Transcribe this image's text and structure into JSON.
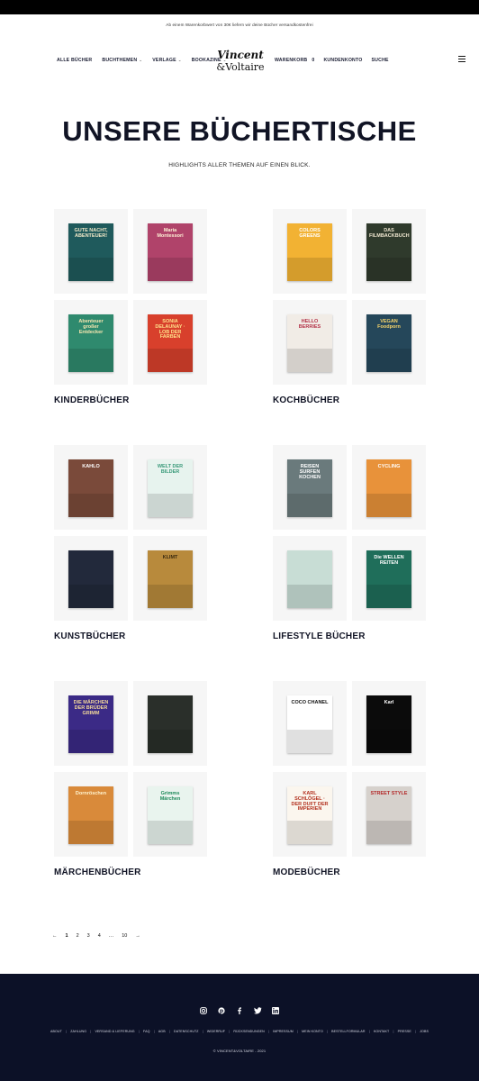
{
  "promo_bar": {
    "text": "Ab einem Warenkorbwert von 30€ liefern wir deine Bücher versandkostenfrei"
  },
  "nav": {
    "left_items": [
      {
        "label": "ALLE BÜCHER",
        "has_dropdown": false
      },
      {
        "label": "BUCHTHEMEN",
        "has_dropdown": true
      },
      {
        "label": "VERLAGE",
        "has_dropdown": true
      },
      {
        "label": "BOOKAZINE",
        "has_dropdown": true
      }
    ],
    "logo": {
      "line1": "Vincent",
      "line2": "&Voltaire"
    },
    "right_items": [
      {
        "label": "WARENKORB"
      },
      {
        "label": "KUNDENKONTO"
      },
      {
        "label": "SUCHE"
      }
    ],
    "cart_count": "0",
    "menu_icon": "hamburger-icon"
  },
  "page": {
    "title": "UNSERE BÜCHERTISCHE",
    "subtitle": "HIGHLIGHTS ALLER THEMEN AUF EINEN BLICK."
  },
  "categories": [
    {
      "label": "KINDERBÜCHER",
      "books": [
        {
          "title": "GUTE NACHT, ABENTEUER!",
          "bg": "#1f5a5c",
          "fg": "#f3e9c8"
        },
        {
          "title": "Maria Montessori",
          "bg": "#b0436a",
          "fg": "#fff1d6"
        },
        {
          "title": "Abenteuer großer Entdecker",
          "bg": "#2f8a6e",
          "fg": "#f7e7b0"
        },
        {
          "title": "SONIA DELAUNAY · LOB DER FARBEN",
          "bg": "#d8402c",
          "fg": "#ffe08a"
        }
      ]
    },
    {
      "label": "KOCHBÜCHER",
      "books": [
        {
          "title": "COLORS GREENS",
          "bg": "#f2b233",
          "fg": "#ffffff"
        },
        {
          "title": "DAS FILMBACKBUCH",
          "bg": "#2f3a2c",
          "fg": "#efe6cf"
        },
        {
          "title": "HELLO BERRIES",
          "bg": "#f1ece6",
          "fg": "#b43248"
        },
        {
          "title": "VEGAN Foodporn",
          "bg": "#25475a",
          "fg": "#f6d46a"
        }
      ]
    },
    {
      "label": "KUNSTBÜCHER",
      "books": [
        {
          "title": "KAHLO",
          "bg": "#7a4a3a",
          "fg": "#ffffff"
        },
        {
          "title": "WELT DER BILDER",
          "bg": "#e7f3ee",
          "fg": "#3a9a7a"
        },
        {
          "title": "",
          "bg": "#22293b",
          "fg": "#d7deea"
        },
        {
          "title": "KLIMT",
          "bg": "#b88a3c",
          "fg": "#3a2a10"
        }
      ]
    },
    {
      "label": "LIFESTYLE BÜCHER",
      "books": [
        {
          "title": "REISEN SURFEN KOCHEN",
          "bg": "#6a7a7c",
          "fg": "#ffffff"
        },
        {
          "title": "CYCLING",
          "bg": "#e8923a",
          "fg": "#ffffff"
        },
        {
          "title": "",
          "bg": "#c8ddd5",
          "fg": "#2a3a33"
        },
        {
          "title": "Die WELLEN REITEN",
          "bg": "#1f6e5a",
          "fg": "#ffffff"
        }
      ]
    },
    {
      "label": "MÄRCHENBÜCHER",
      "books": [
        {
          "title": "DIE MÄRCHEN DER BRÜDER GRIMM",
          "bg": "#3b2a86",
          "fg": "#f3d89a"
        },
        {
          "title": "",
          "bg": "#2a2f2a",
          "fg": "#f2efe1"
        },
        {
          "title": "Dornröschen",
          "bg": "#d98a3a",
          "fg": "#fff4d0"
        },
        {
          "title": "Grimms Märchen",
          "bg": "#e9f4ee",
          "fg": "#1e8a5a"
        }
      ]
    },
    {
      "label": "MODEBÜCHER",
      "books": [
        {
          "title": "COCO CHANEL",
          "bg": "#ffffff",
          "fg": "#111111"
        },
        {
          "title": "Karl",
          "bg": "#0b0b0b",
          "fg": "#ffffff"
        },
        {
          "title": "KARL SCHLÖGEL · DER DUFT DER IMPERIEN",
          "bg": "#fbf6ee",
          "fg": "#b3311f"
        },
        {
          "title": "STREET STYLE",
          "bg": "#d6d1cc",
          "fg": "#b42a2a"
        }
      ]
    }
  ],
  "pagination": {
    "prev": "←",
    "pages": [
      "1",
      "2",
      "3",
      "4",
      "…",
      "10"
    ],
    "next": "→",
    "current": "1"
  },
  "footer": {
    "social": [
      "instagram-icon",
      "pinterest-icon",
      "facebook-icon",
      "twitter-icon",
      "linkedin-icon"
    ],
    "links": [
      "ABOUT",
      "ZAHLUNG",
      "VERSAND & LIEFERUNG",
      "FAQ",
      "AGB",
      "DATENSCHUTZ",
      "WIDERRUF",
      "RÜCKSENDUNGEN",
      "IMPRESSUM",
      "MEIN KONTO",
      "BESTELLFORMULAR",
      "KONTAKT",
      "PRESSE",
      "JOBS"
    ],
    "copyright": "© VINCENT&VOLTAIRE - 2021"
  },
  "colors": {
    "navy": "#0c1127",
    "text": "#111425",
    "tile_bg": "#f6f6f6"
  }
}
